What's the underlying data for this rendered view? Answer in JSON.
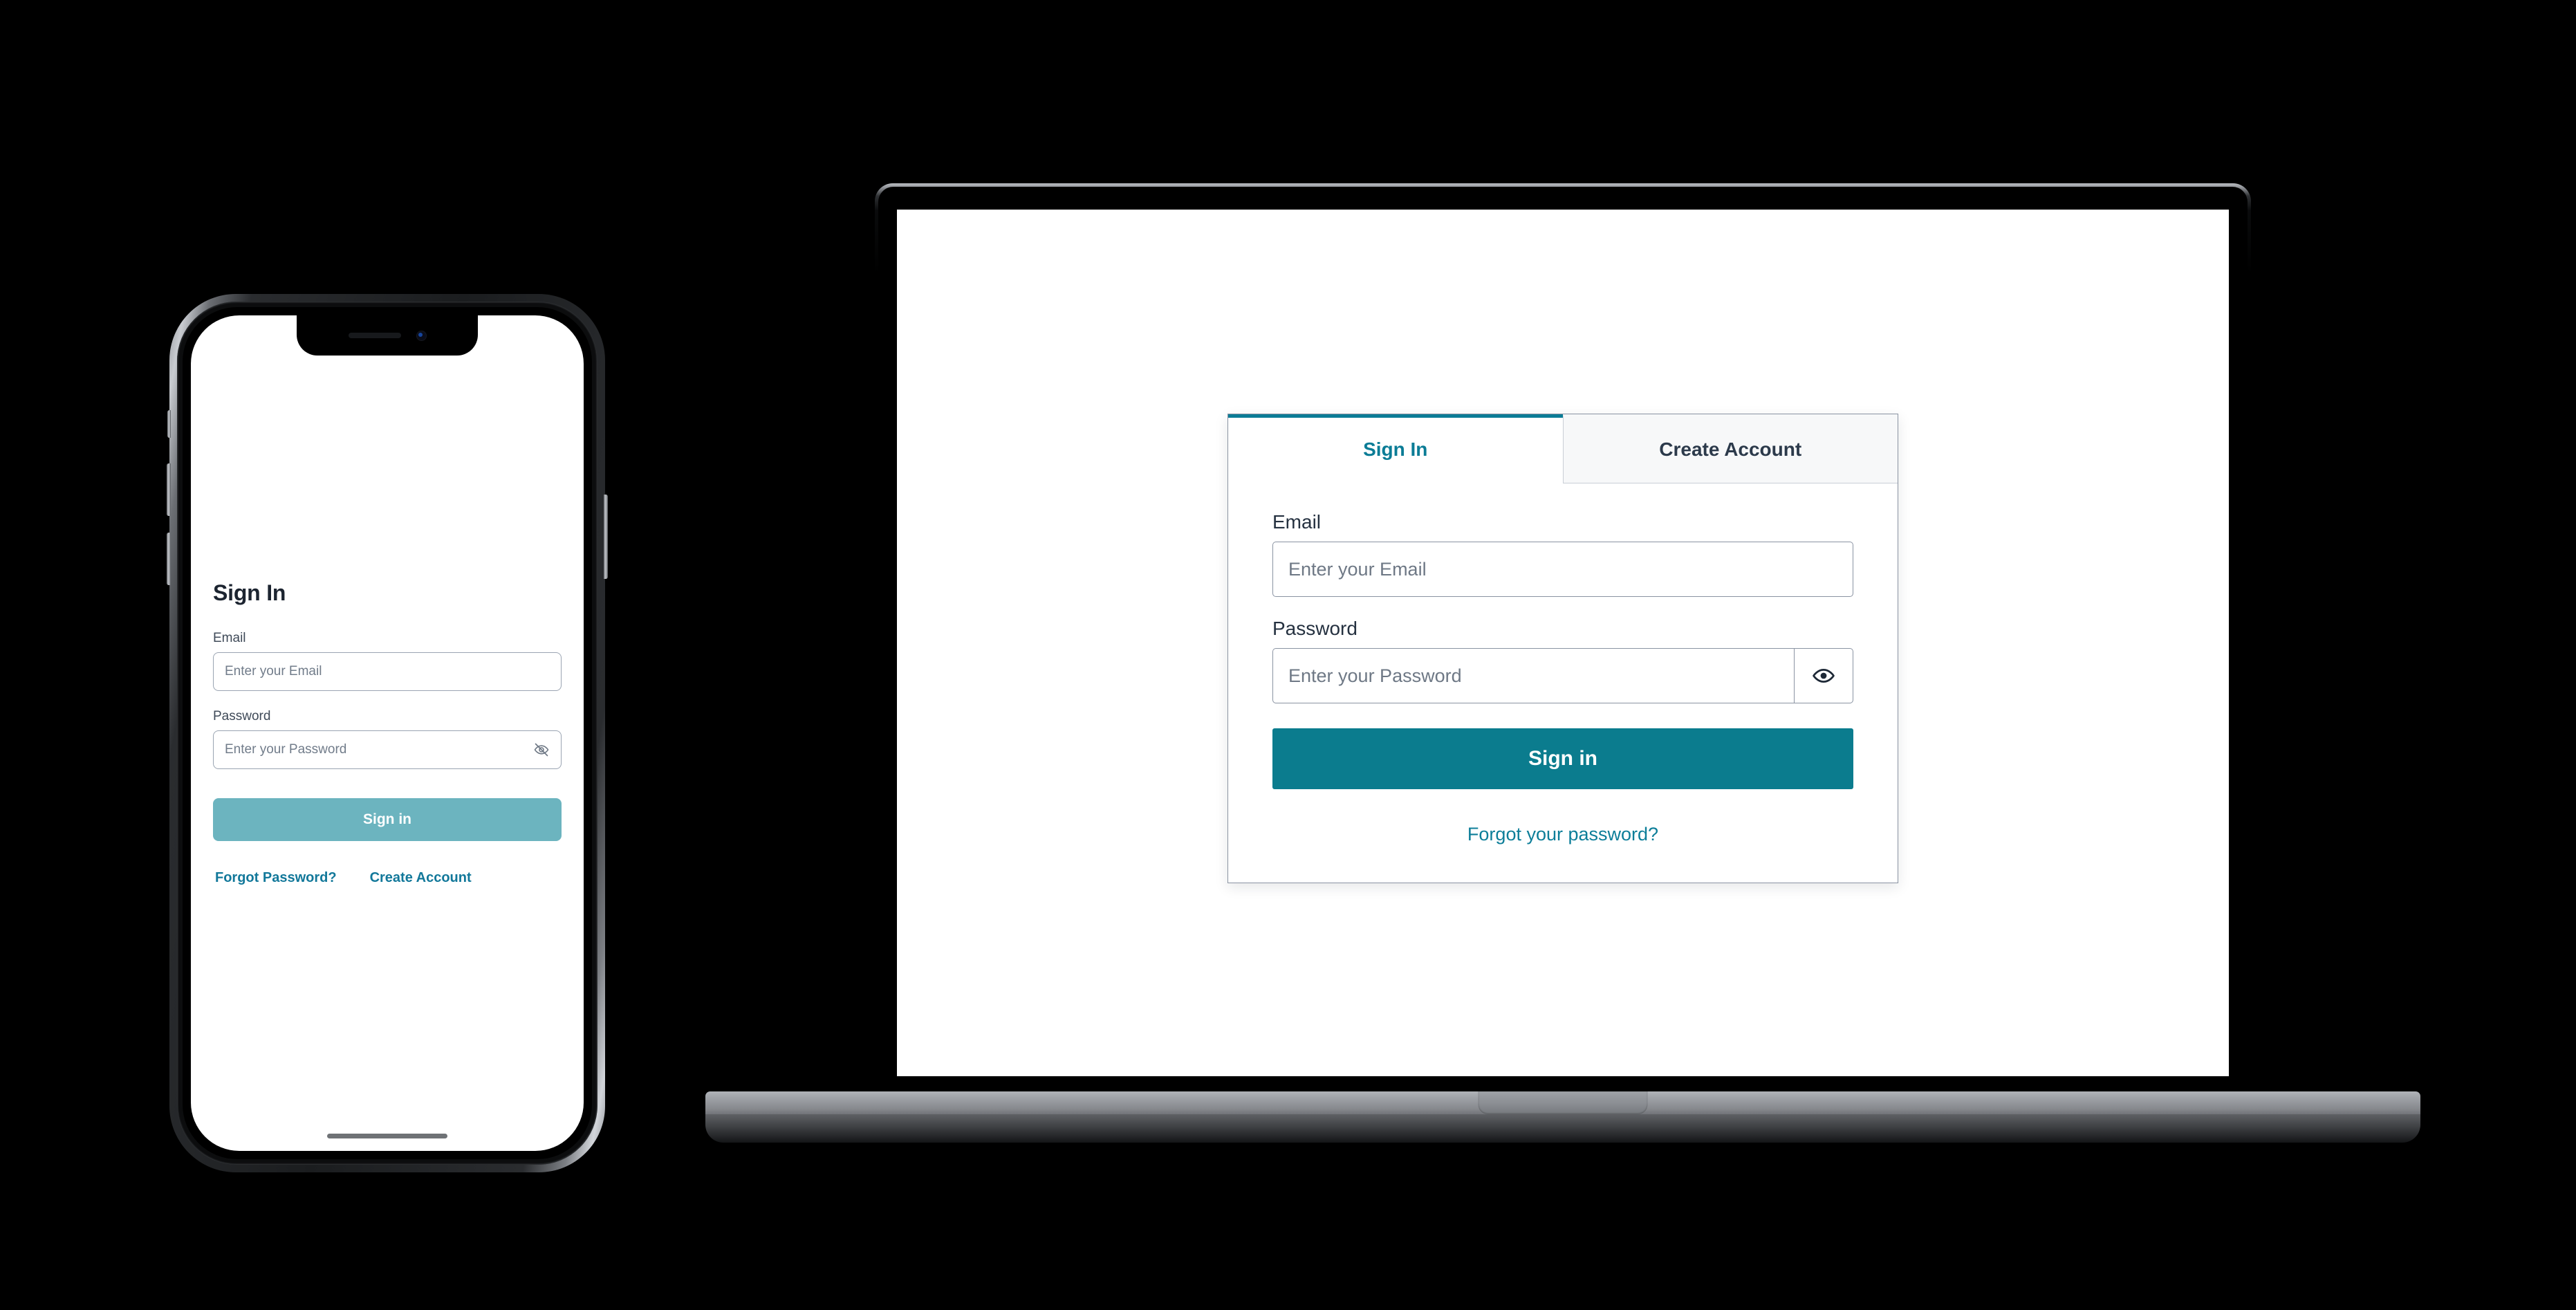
{
  "phone": {
    "title": "Sign In",
    "email": {
      "label": "Email",
      "placeholder": "Enter your Email",
      "value": ""
    },
    "password": {
      "label": "Password",
      "placeholder": "Enter your Password",
      "value": ""
    },
    "submit_label": "Sign in",
    "links": {
      "forgot": "Forgot Password?",
      "create": "Create Account"
    },
    "icons": {
      "toggle_password": "eye-off-icon",
      "notch_speaker": "speaker-grille-icon",
      "notch_camera": "front-camera-icon",
      "home_indicator": "home-indicator"
    },
    "colors": {
      "primary_button": "#6cb4bf",
      "link": "#12789a",
      "title": "#1c2430",
      "border": "#9aa4b2",
      "placeholder": "#717c8a"
    }
  },
  "laptop": {
    "tabs": [
      {
        "label": "Sign In",
        "active": true
      },
      {
        "label": "Create Account",
        "active": false
      }
    ],
    "email": {
      "label": "Email",
      "placeholder": "Enter your Email",
      "value": ""
    },
    "password": {
      "label": "Password",
      "placeholder": "Enter your Password",
      "value": ""
    },
    "submit_label": "Sign in",
    "forgot_label": "Forgot your password?",
    "icons": {
      "toggle_password": "eye-icon"
    },
    "colors": {
      "primary_button": "#0b7c8e",
      "active_tab": "#0b7c96",
      "inactive_tab_text": "#2c3a4b",
      "inactive_tab_bg": "#f7f8f9",
      "link": "#0d7e99",
      "border": "#8a93a2",
      "placeholder": "#6e7885"
    }
  },
  "background": {
    "color": "#000000"
  }
}
